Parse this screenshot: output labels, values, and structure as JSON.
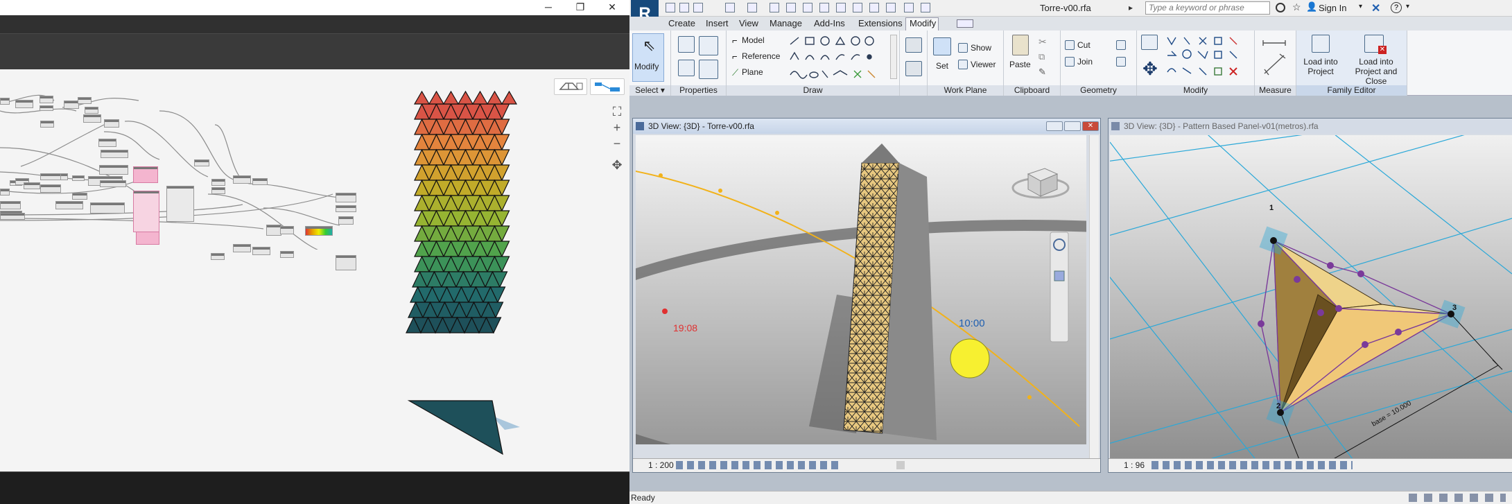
{
  "dynamo": {
    "window_controls": {
      "minimize": "─",
      "restore": "❐",
      "close": "✕"
    },
    "right_toolbar": {
      "zoom_in": "+",
      "zoom_out": "−",
      "fit": "⛶",
      "pan": "✥"
    }
  },
  "revit": {
    "document_title": "Torre-v00.rfa",
    "search_placeholder": "Type a keyword or phrase",
    "sign_in": "Sign In",
    "help": "?",
    "tabs": [
      "Create",
      "Insert",
      "View",
      "Manage",
      "Add-Ins",
      "Extensions",
      "Modify"
    ],
    "active_tab": "Modify",
    "ribbon": {
      "select_group": {
        "modify": "Modify",
        "label": "Select"
      },
      "properties_label": "Properties",
      "draw": {
        "model": "Model",
        "reference": "Reference",
        "plane": "Plane",
        "label": "Draw"
      },
      "work_plane": {
        "set": "Set",
        "show": "Show",
        "viewer": "Viewer",
        "label": "Work Plane"
      },
      "clipboard": {
        "paste": "Paste",
        "label": "Clipboard"
      },
      "geometry": {
        "cut": "Cut",
        "join": "Join",
        "label": "Geometry"
      },
      "modify_label": "Modify",
      "measure_label": "Measure",
      "family_editor": {
        "load_into_project": "Load into Project",
        "load_and_close": "Load into Project and Close",
        "label": "Family Editor"
      }
    },
    "view1": {
      "title": "3D View: {3D} - Torre-v00.rfa",
      "scale": "1 : 200",
      "sunset_time": "19:08",
      "sun_time": "10:00"
    },
    "view2": {
      "title": "3D View: {3D} - Pattern Based Panel-v01(metros).rfa",
      "scale": "1 : 96",
      "point_labels": [
        "1",
        "2",
        "3"
      ],
      "dimension": "base = 10.000"
    },
    "status": "Ready"
  },
  "colors": {
    "dynamo_canvas": "#f4f4f4",
    "revit_ribbon": "#f5f6f8",
    "sun_path": "#f2b21a",
    "sun": "#f7f030",
    "tower_panel": "#e8c880",
    "grid_line": "#2aa8d8",
    "panel_purple": "#7a3a9a"
  }
}
